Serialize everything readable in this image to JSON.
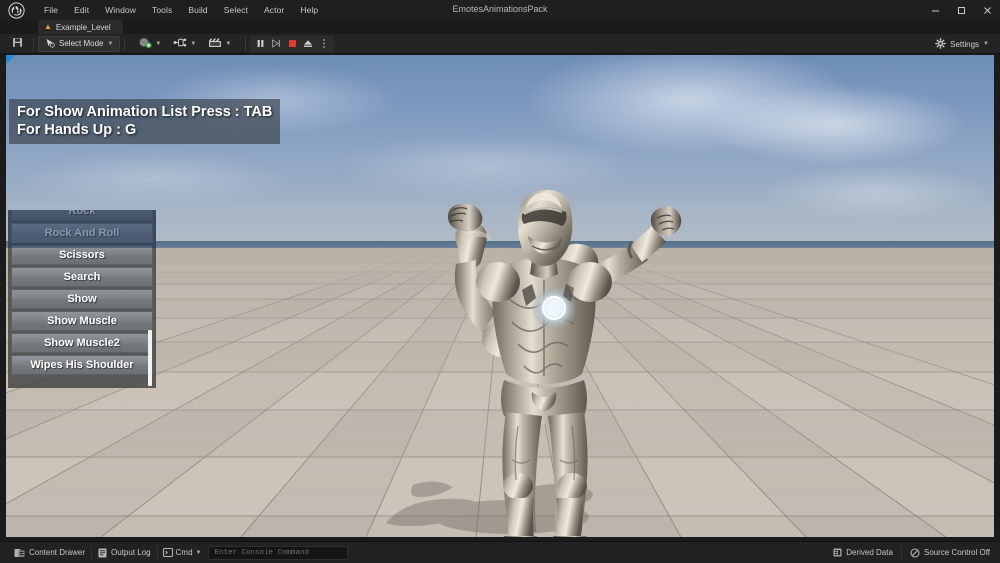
{
  "window": {
    "title": "EmotesAnimationsPack",
    "minimize_label": "—",
    "maximize_label": "❐",
    "close_label": "✕"
  },
  "menubar": {
    "items": [
      {
        "label": "File"
      },
      {
        "label": "Edit"
      },
      {
        "label": "Window"
      },
      {
        "label": "Tools"
      },
      {
        "label": "Build"
      },
      {
        "label": "Select"
      },
      {
        "label": "Actor"
      },
      {
        "label": "Help"
      }
    ]
  },
  "level_tab": {
    "label": "Example_Level",
    "icon": "level-icon"
  },
  "toolbar": {
    "save_icon": "save-icon",
    "mode_label": "Select Mode",
    "add_icon": "add-actor-icon",
    "blueprints_icon": "blueprints-icon",
    "cinematics_icon": "cinematics-icon",
    "play_controls": [
      {
        "name": "pause-button",
        "glyph": "pause"
      },
      {
        "name": "frame-step-button",
        "glyph": "step"
      },
      {
        "name": "stop-button",
        "glyph": "stop"
      },
      {
        "name": "eject-button",
        "glyph": "eject"
      },
      {
        "name": "play-options-button",
        "glyph": "kebab"
      }
    ],
    "settings_label": "Settings",
    "settings_icon": "gear-icon"
  },
  "viewport": {
    "hud_lines": [
      "For Show Animation List Press : TAB",
      "For Hands Up : G"
    ],
    "active_indicator_color": "#1a8cd8"
  },
  "animation_list": {
    "items": [
      {
        "label": "Rock",
        "selected": false,
        "clipped": true
      },
      {
        "label": "Rock And Roll",
        "selected": true,
        "clipped": false
      },
      {
        "label": "Scissors",
        "selected": false,
        "clipped": false
      },
      {
        "label": "Search",
        "selected": false,
        "clipped": false
      },
      {
        "label": "Show",
        "selected": false,
        "clipped": false
      },
      {
        "label": "Show Muscle",
        "selected": false,
        "clipped": false
      },
      {
        "label": "Show Muscle2",
        "selected": false,
        "clipped": false
      },
      {
        "label": "Wipes His Shoulder",
        "selected": false,
        "clipped": false
      }
    ]
  },
  "statusbar": {
    "content_drawer_label": "Content Drawer",
    "content_drawer_icon": "drawer-icon",
    "output_log_label": "Output Log",
    "output_log_icon": "log-icon",
    "cmd_label": "Cmd",
    "cmd_icon": "console-icon",
    "console_placeholder": "Enter Console Command",
    "derived_data_label": "Derived Data",
    "derived_data_icon": "derived-data-icon",
    "source_control_label": "Source Control Off",
    "source_control_icon": "source-control-off-icon"
  },
  "colors": {
    "accent": "#1a8cd8",
    "stop_red": "#e03b2f",
    "level_icon": "#e8a13a",
    "chrome_dark": "#1f1f1f",
    "toolbar": "#242424"
  }
}
